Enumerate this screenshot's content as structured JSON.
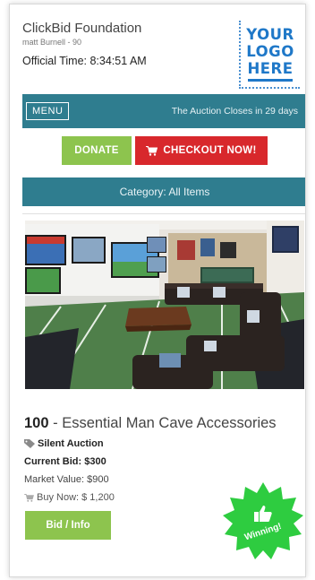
{
  "header": {
    "org_name": "ClickBid Foundation",
    "user_line": "matt Burnell - 90",
    "official_time": "Official Time: 8:34:51 AM",
    "logo_lines": [
      "YOUR",
      "LOGO",
      "HERE"
    ]
  },
  "nav": {
    "menu_label": "MENU",
    "closes_text": "The Auction Closes in 29 days"
  },
  "actions": {
    "donate_label": "DONATE",
    "checkout_label": "CHECKOUT NOW!"
  },
  "category": {
    "label": "Category: All Items"
  },
  "item": {
    "number": "100",
    "title_sep": " - ",
    "title": "Essential Man Cave Accessories",
    "auction_type": "Silent Auction",
    "current_bid": "Current Bid: $300",
    "market_value": "Market Value: $900",
    "buy_now": "Buy Now: $ 1,200",
    "bid_button_label": "Bid / Info",
    "status_badge": "Winning!"
  },
  "colors": {
    "teal": "#2f7d8f",
    "green": "#8dc44e",
    "red": "#d8282c",
    "logo_blue": "#1f78c8",
    "badge_green": "#2ecc40"
  },
  "icons": {
    "cart": "cart-icon",
    "tag": "tag-icon",
    "thumb": "thumbs-up-icon"
  }
}
